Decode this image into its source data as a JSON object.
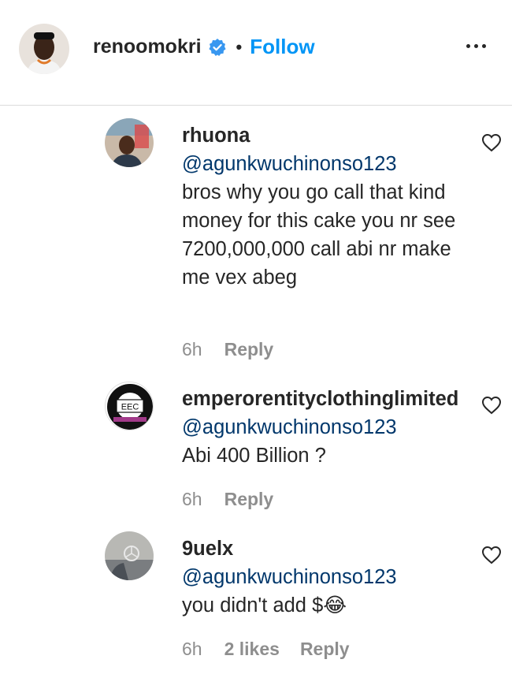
{
  "header": {
    "username": "renoomokri",
    "verified_icon": "verified-badge-icon",
    "separator": "•",
    "follow_label": "Follow",
    "more_icon": "more-options-icon"
  },
  "colors": {
    "follow": "#0095f6",
    "mention": "#00376b",
    "meta": "#8e8e8e",
    "text": "#262626"
  },
  "comments": [
    {
      "username": "rhuona",
      "mention": "@agunkwuchinonso123",
      "text": "bros why you go call that kind money for this cake you nr see 7200,000,000 call abi nr make me vex abeg",
      "time": "6h",
      "likes": "",
      "reply_label": "Reply",
      "like_icon": "heart-icon"
    },
    {
      "username": "emperorentityclothinglimited",
      "avatar_text": "EEC",
      "mention": "@agunkwuchinonso123",
      "text": "Abi 400 Billion ?",
      "time": "6h",
      "likes": "",
      "reply_label": "Reply",
      "like_icon": "heart-icon"
    },
    {
      "username": "9uelx",
      "mention": "@agunkwuchinonso123",
      "text": "you didn't add $😂",
      "time": "6h",
      "likes": "2 likes",
      "reply_label": "Reply",
      "like_icon": "heart-icon"
    }
  ]
}
